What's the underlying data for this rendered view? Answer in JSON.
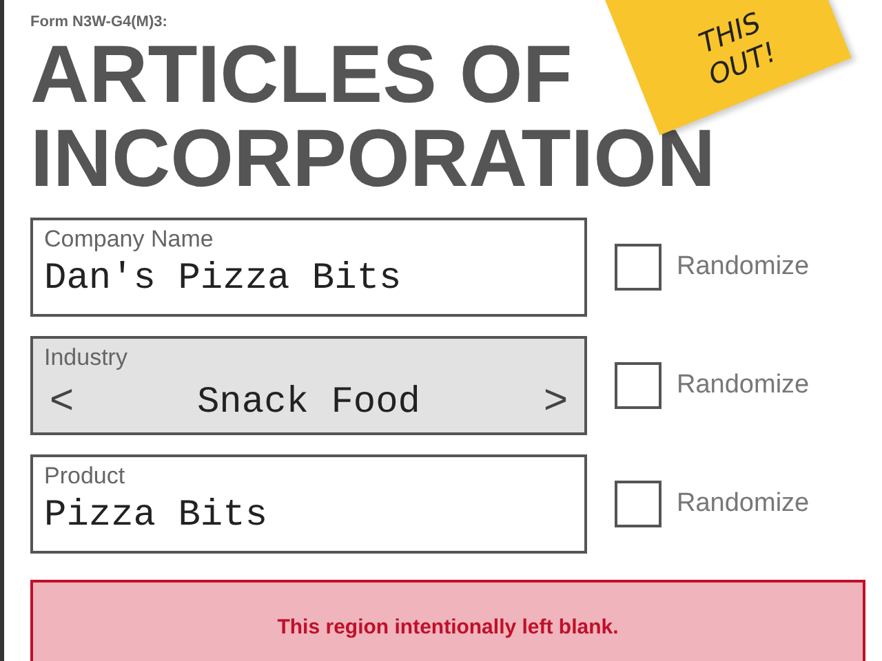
{
  "form_code": "Form N3W-G4(M)3:",
  "heading": [
    "ARTICLES OF",
    "INCORPORATION"
  ],
  "sticky_note": {
    "lines": [
      "THIS",
      "OUT!"
    ]
  },
  "fields": [
    {
      "kind": "text",
      "label": "Company Name",
      "value": "Dan's Pizza Bits",
      "randomize": {
        "label": "Randomize",
        "checked": false
      }
    },
    {
      "kind": "selector",
      "label": "Industry",
      "value": "Snack Food",
      "prev": "<",
      "next": ">",
      "randomize": {
        "label": "Randomize",
        "checked": false
      }
    },
    {
      "kind": "text",
      "label": "Product",
      "value": "Pizza Bits",
      "randomize": {
        "label": "Randomize",
        "checked": false
      }
    }
  ],
  "notice": "This region intentionally left blank."
}
